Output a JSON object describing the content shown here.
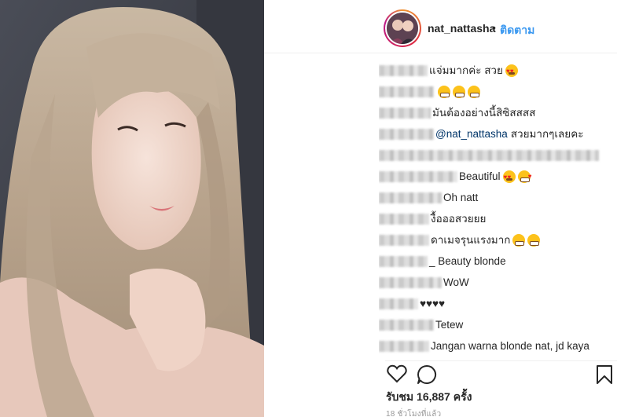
{
  "header": {
    "username": "nat_nattasha",
    "separator": "•",
    "follow_label": "ติดตาม"
  },
  "comments": [
    {
      "text": "แจ่มมากค่ะ สวย",
      "emojis": [
        "heart-eyes"
      ]
    },
    {
      "text": "",
      "emojis": [
        "grimace",
        "grimace",
        "grimace"
      ]
    },
    {
      "text": "มันต้องอย่างนี้สิซิสสสส",
      "emojis": []
    },
    {
      "mention": "@nat_nattasha",
      "text": "สวยมากๆเลยคะ",
      "emojis": []
    },
    {
      "text": "",
      "emojis": []
    },
    {
      "text": "Beautiful",
      "emojis": [
        "heart-eyes",
        "kiss"
      ]
    },
    {
      "text": "Oh natt",
      "emojis": []
    },
    {
      "text": "งื้อออสวยยย",
      "emojis": []
    },
    {
      "text": "ดาเมจรุนแรงมาก",
      "emojis": [
        "grimace",
        "grimace"
      ]
    },
    {
      "text": "_ Beauty blonde",
      "emojis": []
    },
    {
      "text": "WoW",
      "emojis": []
    },
    {
      "text": "♥♥♥♥",
      "emojis": []
    },
    {
      "text": "Tetew",
      "emojis": []
    },
    {
      "text": "Jangan warna blonde nat, jd kaya",
      "emojis": []
    }
  ],
  "actions": {
    "like_icon": "heart-outline-icon",
    "comment_icon": "comment-bubble-icon",
    "save_icon": "bookmark-icon"
  },
  "likes_text": "รับชม 16,887 ครั้ง",
  "time_text": "18 ชั่วโมงที่แล้ว",
  "colors": {
    "link_blue": "#3897f0",
    "mention_blue": "#003569",
    "text": "#262626",
    "muted": "#999999"
  }
}
